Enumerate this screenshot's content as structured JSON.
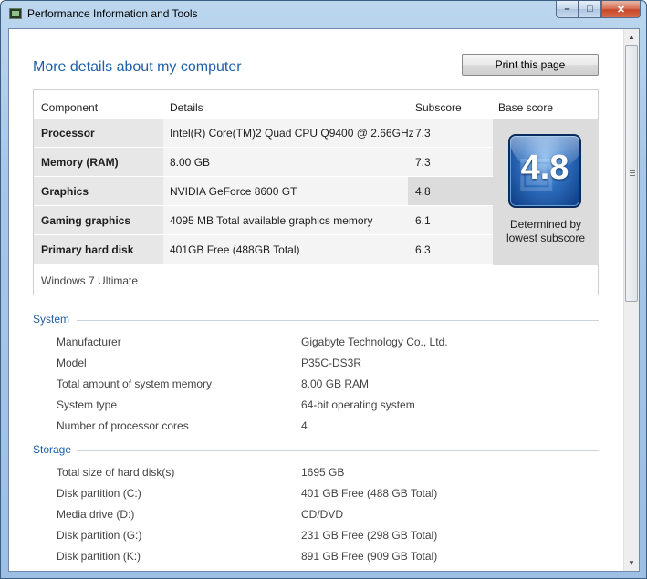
{
  "window": {
    "title": "Performance Information and Tools"
  },
  "caption": {
    "minimize": "–",
    "maximize": "□",
    "close": "✕"
  },
  "page": {
    "heading": "More details about my computer",
    "print_label": "Print this page"
  },
  "scores": {
    "headers": {
      "component": "Component",
      "details": "Details",
      "subscore": "Subscore",
      "base": "Base score"
    },
    "rows": [
      {
        "component": "Processor",
        "details": "Intel(R) Core(TM)2 Quad CPU Q9400 @ 2.66GHz",
        "subscore": "7.3"
      },
      {
        "component": "Memory (RAM)",
        "details": "8.00 GB",
        "subscore": "7.3"
      },
      {
        "component": "Graphics",
        "details": "NVIDIA GeForce 8600 GT",
        "subscore": "4.8"
      },
      {
        "component": "Gaming graphics",
        "details": "4095 MB Total available graphics memory",
        "subscore": "6.1"
      },
      {
        "component": "Primary hard disk",
        "details": "401GB Free (488GB Total)",
        "subscore": "6.3"
      }
    ],
    "base_score": "4.8",
    "determined_line1": "Determined by",
    "determined_line2": "lowest subscore",
    "os": "Windows 7 Ultimate"
  },
  "system": {
    "title": "System",
    "items": [
      {
        "label": "Manufacturer",
        "value": "Gigabyte Technology Co., Ltd."
      },
      {
        "label": "Model",
        "value": "P35C-DS3R"
      },
      {
        "label": "Total amount of system memory",
        "value": "8.00 GB RAM"
      },
      {
        "label": "System type",
        "value": "64-bit operating system"
      },
      {
        "label": "Number of processor cores",
        "value": "4"
      }
    ]
  },
  "storage": {
    "title": "Storage",
    "items": [
      {
        "label": "Total size of hard disk(s)",
        "value": "1695 GB"
      },
      {
        "label": "Disk partition (C:)",
        "value": "401 GB Free (488 GB Total)"
      },
      {
        "label": "Media drive (D:)",
        "value": "CD/DVD"
      },
      {
        "label": "Disk partition (G:)",
        "value": "231 GB Free (298 GB Total)"
      },
      {
        "label": "Disk partition (K:)",
        "value": "891 GB Free (909 GB Total)"
      }
    ]
  },
  "icons": {
    "app": "performance-icon",
    "scroll_up": "▲",
    "scroll_down": "▼"
  }
}
